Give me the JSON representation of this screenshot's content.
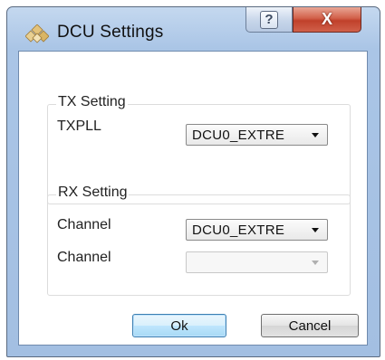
{
  "window": {
    "title": "DCU Settings",
    "help_label": "?",
    "close_label": "X"
  },
  "tx_group": {
    "title": "TX Setting",
    "txpll_label": "TXPLL",
    "txpll_value": "DCU0_EXTRE"
  },
  "rx_group": {
    "title": "RX Setting",
    "channel1_label": "Channel",
    "channel1_value": "DCU0_EXTRE",
    "channel2_label": "Channel",
    "channel2_value": ""
  },
  "buttons": {
    "ok_label": "Ok",
    "cancel_label": "Cancel"
  },
  "icons": {
    "app": "settings-diamond-icon",
    "combo_arrow": "chevron-down-icon"
  },
  "colors": {
    "titlebar": "#aac5e6",
    "close_button": "#c9452f",
    "default_button": "#bee6fd"
  }
}
